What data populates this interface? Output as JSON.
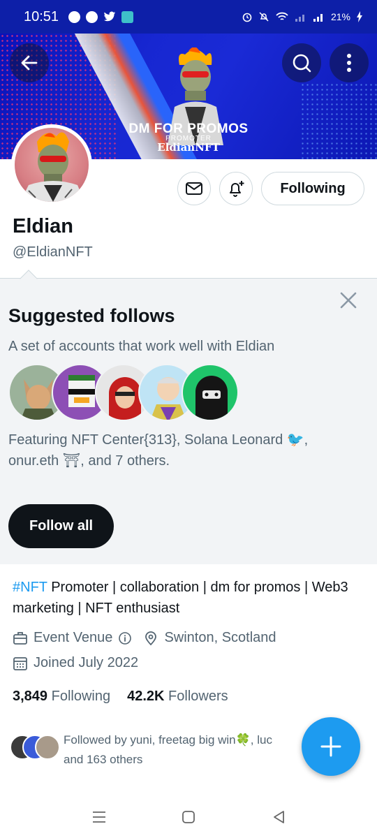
{
  "status_bar": {
    "time": "10:51",
    "battery": "21%",
    "background": "#0d1fa8"
  },
  "banner": {
    "promo": "DM FOR PROMOS",
    "role": "PROMOTER",
    "brand": "EldianNFT"
  },
  "header": {
    "back_icon": "arrow-left-icon",
    "search_icon": "search-icon",
    "more_icon": "more-vertical-icon"
  },
  "profile": {
    "name": "Eldian",
    "handle": "@EldianNFT",
    "following_label": "Following"
  },
  "suggested": {
    "title": "Suggested follows",
    "description": "A set of accounts that work well with Eldian",
    "featuring": "Featuring NFT Center{313}, Solana Leonard 🐦, onur.eth ⛩, and 7 others.",
    "follow_all_label": "Follow all"
  },
  "bio": {
    "hashtag": "#NFT",
    "text": " Promoter | collaboration | dm for promos  | Web3 marketing | NFT enthusiast"
  },
  "meta": {
    "category": "Event Venue",
    "location": "Swinton, Scotland",
    "joined": "Joined July 2022"
  },
  "counts": {
    "following_count": "3,849",
    "following_label": "Following",
    "followers_count": "42.2K",
    "followers_label": "Followers"
  },
  "followed_by": {
    "text": "Followed by yuni, freetag big win🍀, luc",
    "text2": "and 163 others"
  },
  "colors": {
    "accent": "#1d9bf0",
    "text": "#0f1419",
    "secondary": "#536471"
  }
}
